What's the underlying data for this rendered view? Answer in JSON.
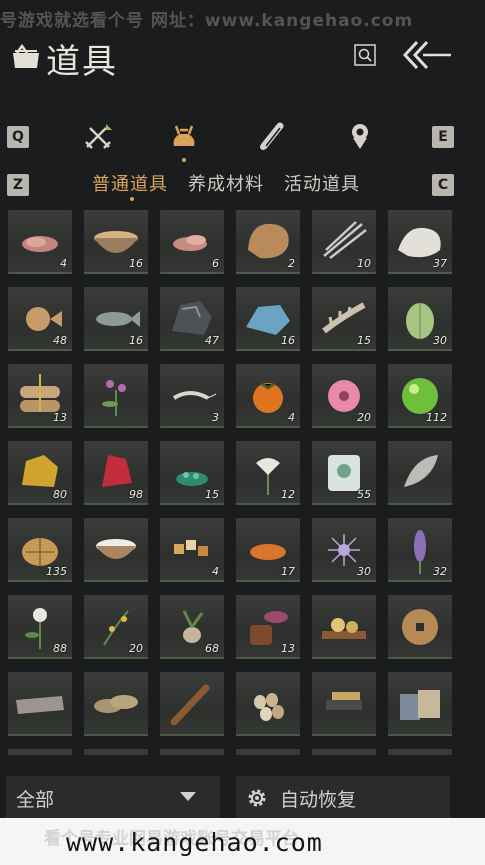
{
  "watermark_top": "号游戏就选看个号   网址：www.kangehao.com",
  "header": {
    "title": "道具",
    "search_icon": "search-icon",
    "back_icon": "back-arrow-icon"
  },
  "categories": {
    "left_key": "Q",
    "right_key": "E",
    "sub_left_key": "Z",
    "sub_right_key": "C",
    "icons": [
      "crossed-swords-icon",
      "pouch-icon",
      "scroll-icon",
      "badge-icon"
    ],
    "active_index": 1
  },
  "sub_tabs": [
    {
      "label": "普通道具",
      "active": true
    },
    {
      "label": "养成材料",
      "active": false
    },
    {
      "label": "活动道具",
      "active": false
    }
  ],
  "items": [
    {
      "icon": "raw-meat-icon",
      "qty": "4"
    },
    {
      "icon": "porridge-bowl-icon",
      "qty": "16"
    },
    {
      "icon": "meat-slices-icon",
      "qty": "6"
    },
    {
      "icon": "fur-pelt-icon",
      "qty": "2"
    },
    {
      "icon": "feathers-icon",
      "qty": "10"
    },
    {
      "icon": "white-fur-icon",
      "qty": "37"
    },
    {
      "icon": "pufferfish-icon",
      "qty": "48"
    },
    {
      "icon": "fish-icon",
      "qty": "16"
    },
    {
      "icon": "black-ore-icon",
      "qty": "47"
    },
    {
      "icon": "blue-ore-icon",
      "qty": "16"
    },
    {
      "icon": "bones-icon",
      "qty": "15"
    },
    {
      "icon": "melon-icon",
      "qty": "30"
    },
    {
      "icon": "cloth-bundle-icon",
      "qty": "13"
    },
    {
      "icon": "purple-flower-herb-icon",
      "qty": ""
    },
    {
      "icon": "shrimp-icon",
      "qty": "3"
    },
    {
      "icon": "persimmon-icon",
      "qty": "4"
    },
    {
      "icon": "pink-flower-icon",
      "qty": "20"
    },
    {
      "icon": "green-orb-icon",
      "qty": "112"
    },
    {
      "icon": "gold-nugget-icon",
      "qty": "80"
    },
    {
      "icon": "red-crystal-icon",
      "qty": "98"
    },
    {
      "icon": "green-gravel-icon",
      "qty": "15"
    },
    {
      "icon": "white-lily-icon",
      "qty": "12"
    },
    {
      "icon": "jade-stone-icon",
      "qty": "55"
    },
    {
      "icon": "grey-feather-icon",
      "qty": ""
    },
    {
      "icon": "woven-shell-icon",
      "qty": "135"
    },
    {
      "icon": "rice-bowl-icon",
      "qty": ""
    },
    {
      "icon": "cubes-icon",
      "qty": "4"
    },
    {
      "icon": "orange-flake-icon",
      "qty": "17"
    },
    {
      "icon": "purple-spikes-icon",
      "qty": "30"
    },
    {
      "icon": "lavender-stalk-icon",
      "qty": "32"
    },
    {
      "icon": "white-flower-plant-icon",
      "qty": "88"
    },
    {
      "icon": "yellow-berry-herb-icon",
      "qty": "20"
    },
    {
      "icon": "root-herb-icon",
      "qty": "68"
    },
    {
      "icon": "mushroom-jar-icon",
      "qty": "13"
    },
    {
      "icon": "mooncake-tray-icon",
      "qty": ""
    },
    {
      "icon": "bronze-coin-icon",
      "qty": ""
    },
    {
      "icon": "wood-block-icon",
      "qty": ""
    },
    {
      "icon": "straw-sandals-icon",
      "qty": ""
    },
    {
      "icon": "brown-stick-icon",
      "qty": ""
    },
    {
      "icon": "eggs-icon",
      "qty": ""
    },
    {
      "icon": "ink-stick-icon",
      "qty": ""
    },
    {
      "icon": "books-icon",
      "qty": ""
    }
  ],
  "bottom": {
    "filter_label": "全部",
    "auto_label": "自动恢复"
  },
  "watermark_bottom": {
    "faint": "看个号专业网易游戏账号交易平台",
    "url": "www.kangehao.com"
  }
}
